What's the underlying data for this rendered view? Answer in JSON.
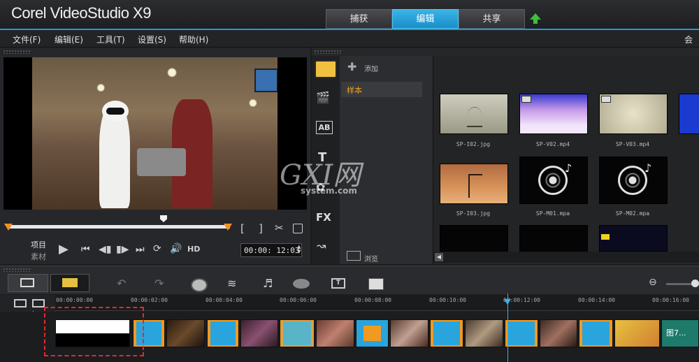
{
  "app": {
    "title": "Corel VideoStudio X9"
  },
  "workspace_tabs": [
    {
      "label": "捕获"
    },
    {
      "label": "编辑"
    },
    {
      "label": "共享"
    }
  ],
  "menu": {
    "items": [
      "文件(F)",
      "编辑(E)",
      "工具(T)",
      "设置(S)",
      "帮助(H)"
    ],
    "right_item": "会声"
  },
  "player": {
    "mode_project": "项目",
    "mode_clip": "素材",
    "hd_label": "HD",
    "timecode": "00:00: 12:03",
    "mark_in": "[",
    "mark_out": "]"
  },
  "library": {
    "add_label": "添加",
    "folder_name": "样本",
    "browse_label": "浏览",
    "items": [
      {
        "name": "SP-I02.jpg",
        "kind": "photo-tree"
      },
      {
        "name": "SP-V02.mp4",
        "kind": "video-purple"
      },
      {
        "name": "SP-V03.mp4",
        "kind": "video-beige"
      },
      {
        "name": "SP-I03.jpg",
        "kind": "photo-desert"
      },
      {
        "name": "SP-M01.mpa",
        "kind": "audio"
      },
      {
        "name": "SP-M02.mpa",
        "kind": "audio"
      }
    ]
  },
  "watermark": {
    "main": "GXI网",
    "sub": "system.com"
  },
  "timeline": {
    "ruler": [
      "00:00:00:00",
      "00:00:02:00",
      "00:00:04:00",
      "00:00:06:00",
      "00:00:08:00",
      "00:00:10:00",
      "00:00:12:00",
      "00:00:14:00",
      "00:00:16:00"
    ],
    "last_clip_label": "图7..."
  },
  "colors": {
    "accent": "#1a8ec8",
    "trim": "#f0902a",
    "selection": "#e62828",
    "transition": "#f09a22"
  }
}
